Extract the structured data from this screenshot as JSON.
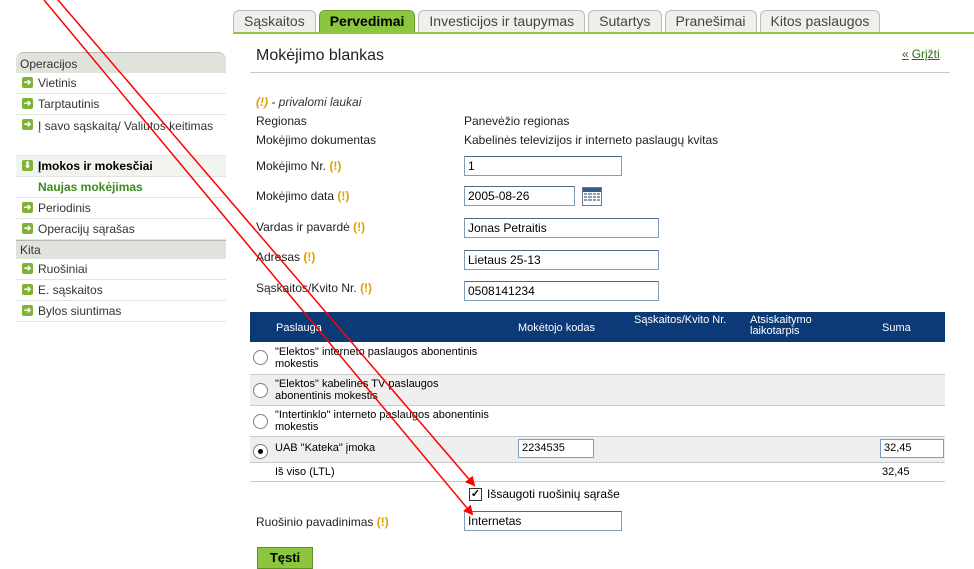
{
  "tabs": [
    "Sąskaitos",
    "Pervedimai",
    "Investicijos ir taupymas",
    "Sutartys",
    "Pranešimai",
    "Kitos paslaugos"
  ],
  "sidebar": {
    "section1": "Operacijos",
    "items": [
      "Vietinis",
      "Tarptautinis",
      "Į savo sąskaitą/ Valiutos keitimas",
      "Įmokos ir mokesčiai",
      "Naujas mokėjimas",
      "Periodinis",
      "Operacijų sąrašas"
    ],
    "section2": "Kita",
    "items2": [
      "Ruošiniai",
      "E. sąskaitos",
      "Bylos siuntimas"
    ]
  },
  "page": {
    "title": "Mokėjimo blankas",
    "back": "Grįžti",
    "back_icon": "«",
    "required_marker": "(!)",
    "required_note": " - privalomi laukai"
  },
  "fields": {
    "region_label": "Regionas",
    "region_value": "Panevėžio regionas",
    "doc_label": "Mokėjimo dokumentas",
    "doc_value": "Kabelinės televizijos ir interneto paslaugų kvitas",
    "nr_label": "Mokėjimo Nr.",
    "nr_value": "1",
    "date_label": "Mokėjimo data",
    "date_value": "2005-08-26",
    "name_label": "Vardas ir pavardė",
    "name_value": "Jonas Petraitis",
    "address_label": "Adresas",
    "address_value": "Lietaus 25-13",
    "invoice_label": "Sąskaitos/Kvito Nr.",
    "invoice_value": "0508141234"
  },
  "table": {
    "headers": [
      "Paslauga",
      "Mokėtojo kodas",
      "Sąskaitos/Kvito Nr.",
      "Atsiskaitymo laikotarpis",
      "Suma"
    ],
    "rows": [
      {
        "service": "\"Elektos\" interneto paslaugos abonentinis mokestis",
        "selected": false
      },
      {
        "service": "\"Elektos\" kabelinės TV paslaugos abonentinis mokestis",
        "selected": false
      },
      {
        "service": "\"Intertinklo\" interneto paslaugos abonentinis mokestis",
        "selected": false
      },
      {
        "service": "UAB \"Kateka\" įmoka",
        "selected": true,
        "payer_code": "2234535",
        "amount": "32,45"
      }
    ],
    "total_label": "Iš viso (LTL)",
    "total_value": "32,45"
  },
  "save_checkbox": {
    "label": "Išsaugoti ruošinių sąraše",
    "checked": true
  },
  "template_name": {
    "label": "Ruošinio pavadinimas",
    "value": "Internetas"
  },
  "continue_button": "Tęsti",
  "annotation_color": "#ff0000"
}
